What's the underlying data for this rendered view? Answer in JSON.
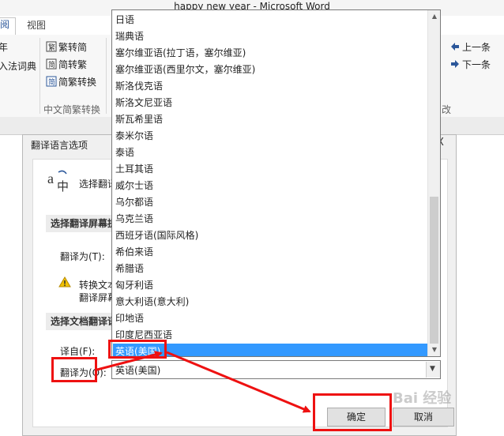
{
  "app": {
    "window_title": "happy new year - Microsoft Word"
  },
  "ribbon": {
    "tabs": [
      "阅",
      "视图"
    ],
    "buttons": {
      "trad_to_simp": "繁转简",
      "simp_to_trad": "简转繁",
      "simp_trad_convert": "简繁转换",
      "ime_dictionary": "入法词典",
      "previous": "上一条",
      "next": "下一条"
    },
    "partial_left": "年",
    "group_labels": {
      "chinese_convert": "中文简繁转换",
      "right_partial": "改"
    }
  },
  "dialog": {
    "title": "翻译语言选项",
    "close": "X",
    "header_text": "选择翻译",
    "screen_section": "选择翻译屏幕提",
    "translate_to_label_1": "翻译为(T):",
    "warning_line1": "转换文本",
    "warning_line2": "翻译屏幕",
    "doc_section": "选择文档翻译语",
    "translate_from_label": "译自(F):",
    "translate_to_label_2": "翻译为(O):",
    "ok_button": "确定",
    "cancel_button": "取消"
  },
  "dropdown": {
    "items": [
      "日语",
      "瑞典语",
      "塞尔维亚语(拉丁语，塞尔维亚)",
      "塞尔维亚语(西里尔文，塞尔维亚)",
      "斯洛伐克语",
      "斯洛文尼亚语",
      "斯瓦希里语",
      "泰米尔语",
      "泰语",
      "土耳其语",
      "威尔士语",
      "乌尔都语",
      "乌克兰语",
      "西班牙语(国际风格)",
      "希伯来语",
      "希腊语",
      "匈牙利语",
      "意大利语(意大利)",
      "印地语",
      "印度尼西亚语",
      "英语(美国)"
    ],
    "selected_index": 20,
    "selected_value": "英语(美国)"
  },
  "watermark": "Bai 经验",
  "colors": {
    "selection": "#3399ff",
    "annotation": "#ee1111",
    "ribbon_accent": "#2b579a"
  }
}
